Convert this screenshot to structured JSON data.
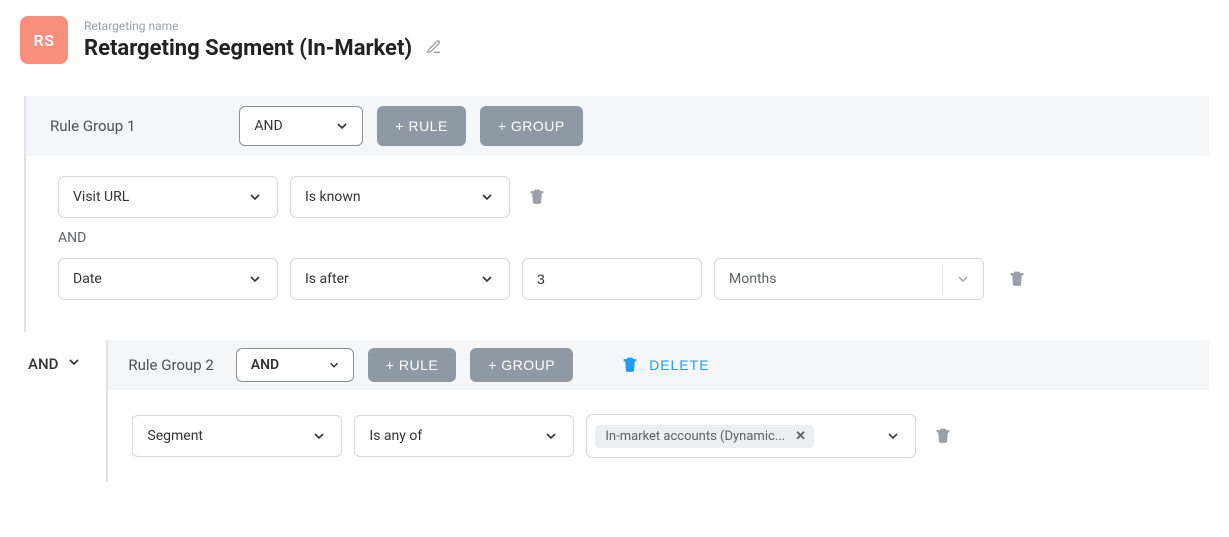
{
  "header": {
    "avatar_initials": "RS",
    "label": "Retargeting name",
    "title": "Retargeting Segment (In-Market)"
  },
  "buttons": {
    "add_rule": "+ RULE",
    "add_group": "+ GROUP",
    "delete": "DELETE"
  },
  "logic": {
    "and": "AND"
  },
  "group1": {
    "title": "Rule Group 1",
    "operator": "AND",
    "rule1": {
      "field": "Visit URL",
      "condition": "Is known"
    },
    "rule2": {
      "field": "Date",
      "condition": "Is after",
      "value": "3",
      "unit": "Months"
    }
  },
  "connector_operator": "AND",
  "group2": {
    "title": "Rule Group 2",
    "operator": "AND",
    "rule1": {
      "field": "Segment",
      "condition": "Is any of",
      "tag": "In-market accounts (Dynamic..."
    }
  }
}
